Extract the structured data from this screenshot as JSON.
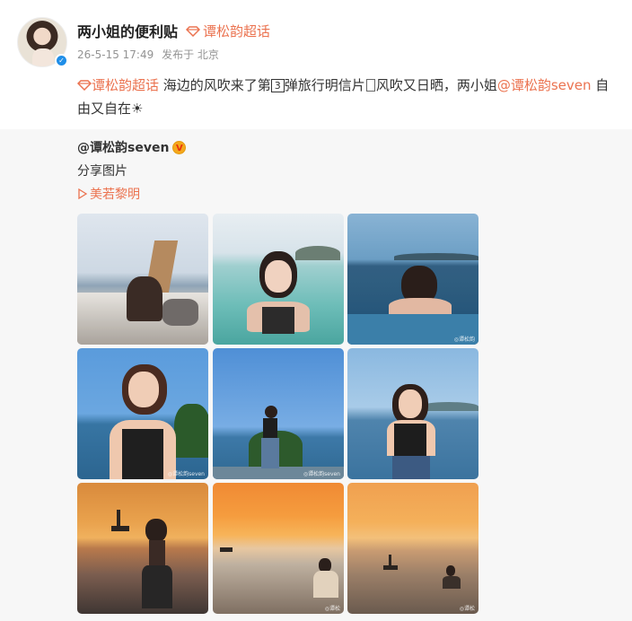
{
  "post": {
    "username": "两小姐的便利贴",
    "super_topic": "谭松韵超话",
    "date": "26-5-15 17:49",
    "location": "发布于 北京",
    "text": {
      "topic": "谭松韵超话",
      "part1": " 海边的风吹来了第",
      "num": "3",
      "part2": "弹旅行明信片",
      "part3": "风吹又日晒，两小姐",
      "mention": "@谭松韵seven",
      "part4": " 自由又自在☀"
    }
  },
  "repost": {
    "username": "@谭松韵seven",
    "badge": "V",
    "text": "分享图片",
    "video_link": "美若黎明"
  },
  "photos": [
    {
      "name": "photo-boat"
    },
    {
      "name": "photo-swim"
    },
    {
      "name": "photo-pool"
    },
    {
      "name": "photo-glasses"
    },
    {
      "name": "photo-standing-far"
    },
    {
      "name": "photo-standing-near"
    },
    {
      "name": "photo-sunset-walk"
    },
    {
      "name": "photo-sunset-sit"
    },
    {
      "name": "photo-sunset-boat"
    }
  ],
  "colors": {
    "link": "#eb7350",
    "verified": "#1f8ee8",
    "repost_bg": "#f7f7f7"
  }
}
